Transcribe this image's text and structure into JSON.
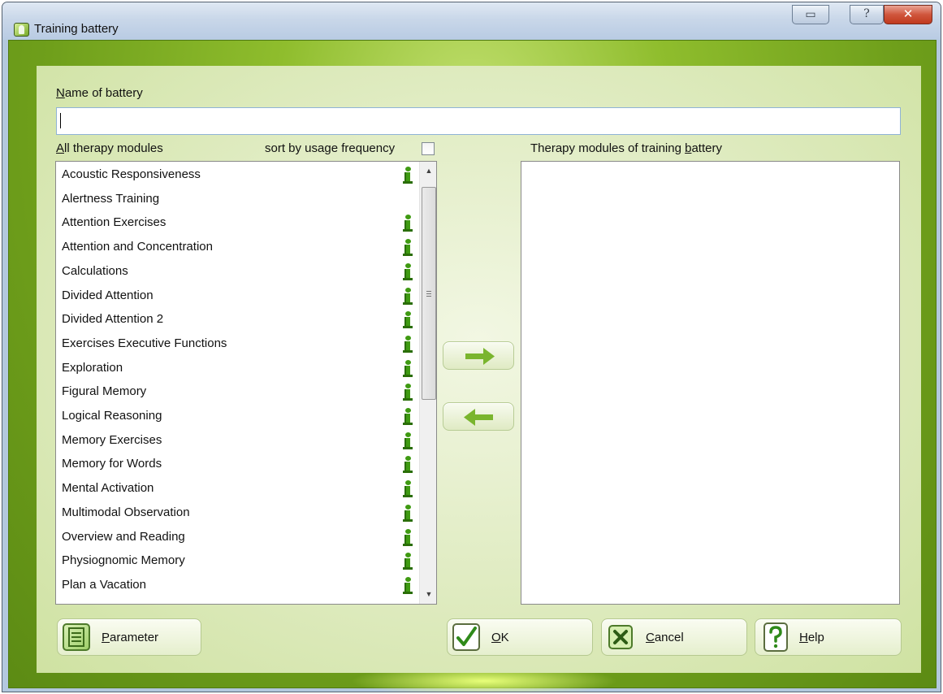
{
  "window": {
    "title": "Training battery",
    "caption_buttons": {
      "restore": "▭",
      "help": "?",
      "close": "✕"
    }
  },
  "form": {
    "name_label": {
      "pre": "",
      "key": "N",
      "post": "ame of battery"
    },
    "name_value": "",
    "all_modules_label": {
      "pre": "",
      "key": "A",
      "post": "ll therapy modules"
    },
    "sort_label": "sort by usage frequency",
    "sort_checked": false,
    "battery_modules_label": {
      "pre": "Therapy modules of training ",
      "key": "b",
      "post": "attery"
    }
  },
  "modules": [
    {
      "label": "Acoustic Responsiveness",
      "info": true
    },
    {
      "label": "Alertness Training",
      "info": false
    },
    {
      "label": "Attention Exercises",
      "info": true
    },
    {
      "label": "Attention and Concentration",
      "info": true
    },
    {
      "label": "Calculations",
      "info": true
    },
    {
      "label": "Divided Attention",
      "info": true
    },
    {
      "label": "Divided Attention 2",
      "info": true
    },
    {
      "label": "Exercises Executive Functions",
      "info": true
    },
    {
      "label": "Exploration",
      "info": true
    },
    {
      "label": "Figural Memory",
      "info": true
    },
    {
      "label": "Logical Reasoning",
      "info": true
    },
    {
      "label": "Memory Exercises",
      "info": true
    },
    {
      "label": "Memory for Words",
      "info": true
    },
    {
      "label": "Mental Activation",
      "info": true
    },
    {
      "label": "Multimodal Observation",
      "info": true
    },
    {
      "label": "Overview and Reading",
      "info": true
    },
    {
      "label": "Physiognomic Memory",
      "info": true
    },
    {
      "label": "Plan a Vacation",
      "info": true
    }
  ],
  "battery_modules": [],
  "buttons": {
    "parameter": {
      "pre": "",
      "key": "P",
      "post": "arameter"
    },
    "ok": {
      "pre": "",
      "key": "O",
      "post": "K"
    },
    "cancel": {
      "pre": "",
      "key": "C",
      "post": "ancel"
    },
    "help": {
      "pre": "",
      "key": "H",
      "post": "elp"
    }
  },
  "icons": {
    "info": "info-icon",
    "add": "arrow-right-icon",
    "remove": "arrow-left-icon",
    "parameter": "parameter-icon",
    "ok": "checkmark-icon",
    "cancel": "x-icon",
    "help": "question-icon"
  },
  "colors": {
    "accent_green": "#6a9e1c",
    "arrow_green": "#7ab52e",
    "info_green": "#3f9a12"
  }
}
